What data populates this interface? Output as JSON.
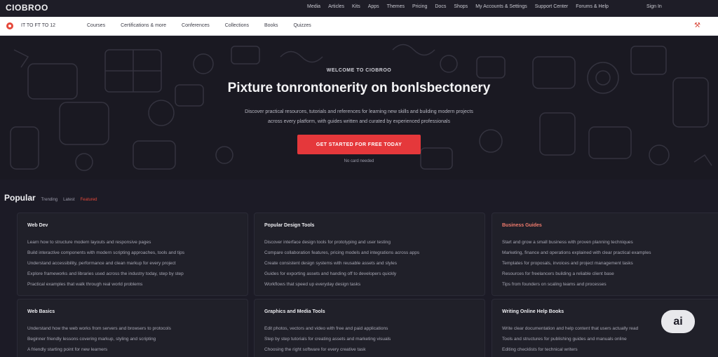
{
  "site": {
    "logo": "CIOBROO"
  },
  "top_nav": {
    "links": [
      "Media",
      "Articles",
      "Kits",
      "Apps",
      "Themes",
      "Pricing",
      "Docs",
      "Shops",
      "My Accounts & Settings",
      "Support Center",
      "Forums & Help"
    ],
    "signin": "Sign In"
  },
  "sub_nav": {
    "brand_text": "IT TO FT TO 12",
    "links": [
      "Courses",
      "Certifications & more",
      "Conferences",
      "Collections",
      "Books",
      "Quizzes"
    ],
    "tool_icon": "tools-icon"
  },
  "hero": {
    "eyebrow": "WELCOME TO CIOBROO",
    "title": "Pixture tonrontonerity on bonlsbectonery",
    "subtitle_line1": "Discover practical resources, tutorials and references for learning new skills and building modern projects",
    "subtitle_line2": "across every platform, with guides written and curated by experienced professionals",
    "cta_label": "GET STARTED FOR FREE TODAY",
    "cta_note": "No card needed"
  },
  "section": {
    "title": "Popular",
    "tabs": [
      "Trending",
      "Latest",
      "Featured"
    ]
  },
  "cards": [
    {
      "title": "Web Dev",
      "title_accent": false,
      "lines": [
        "Learn how to structure modern layouts and responsive pages",
        "Build interactive components with modern scripting approaches, tools and tips",
        "Understand accessibility, performance and clean markup for every project",
        "Explore frameworks and libraries used across the industry today, step by step",
        "Practical examples that walk through real world problems"
      ]
    },
    {
      "title": "Popular Design Tools",
      "title_accent": false,
      "lines": [
        "Discover interface design tools for prototyping and user testing",
        "Compare collaboration features, pricing models and integrations across apps",
        "Create consistent design systems with reusable assets and styles",
        "Guides for exporting assets and handing off to developers quickly",
        "Workflows that speed up everyday design tasks"
      ]
    },
    {
      "title": "Business Guides",
      "title_accent": true,
      "lines": [
        "Start and grow a small business with proven planning techniques",
        "Marketing, finance and operations explained with clear practical examples",
        "Templates for proposals, invoices and project management tasks",
        "Resources for freelancers building a reliable client base",
        "Tips from founders on scaling teams and processes"
      ]
    },
    {
      "title": "Web Basics",
      "title_accent": false,
      "lines": [
        "Understand how the web works from servers and browsers to protocols",
        "Beginner friendly lessons covering markup, styling and scripting",
        "A friendly starting point for new learners"
      ]
    },
    {
      "title": "Graphics and Media Tools",
      "title_accent": false,
      "lines": [
        "Edit photos, vectors and video with free and paid applications",
        "Step by step tutorials for creating assets and marketing visuals",
        "Choosing the right software for every creative task"
      ]
    },
    {
      "title": "Writing Online Help Books",
      "title_accent": false,
      "lines": [
        "Write clear documentation and help content that users actually read",
        "Tools and structures for publishing guides and manuals online",
        "Editing checklists for technical writers"
      ]
    }
  ],
  "ai_badge": "ai"
}
